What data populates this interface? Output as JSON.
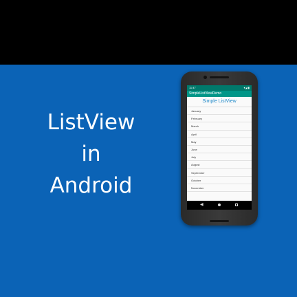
{
  "headline": {
    "line1": "ListView",
    "line2": "in",
    "line3": "Android"
  },
  "phone": {
    "status_time": "11:47",
    "status_icons": "▾◢ ▮",
    "app_title": "SimpleListViewDemo",
    "list_title": "Simple ListView",
    "items": [
      "January",
      "February",
      "March",
      "April",
      "May",
      "June",
      "July",
      "August",
      "September",
      "October",
      "November"
    ],
    "nav_back": "◀"
  },
  "colors": {
    "panel_blue": "#0b63b6",
    "status_bar": "#00796b",
    "app_bar": "#009688",
    "list_title": "#1e88c8"
  }
}
